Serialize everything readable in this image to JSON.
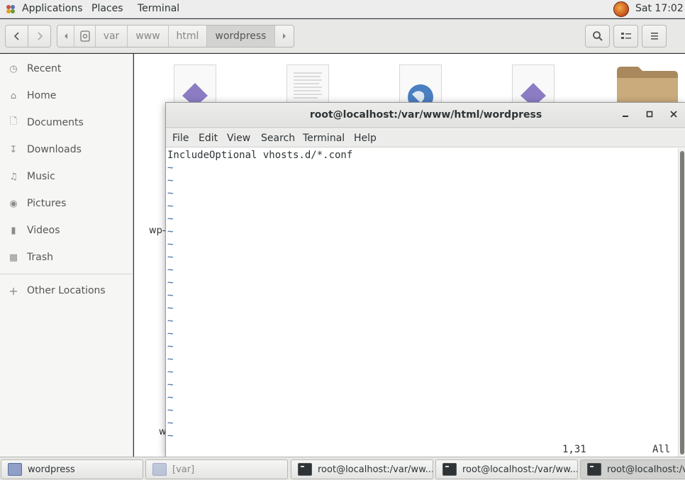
{
  "topbar": {
    "applications": "Applications",
    "places": "Places",
    "terminal": "Terminal",
    "clock": "Sat 17:02"
  },
  "nautilus": {
    "breadcrumbs": [
      "var",
      "www",
      "html",
      "wordpress"
    ],
    "active_crumb": "wordpress",
    "partial_labels": [
      "wp-",
      "w"
    ]
  },
  "sidebar": {
    "items": [
      {
        "label": "Recent",
        "icon": "clock-icon"
      },
      {
        "label": "Home",
        "icon": "home-icon"
      },
      {
        "label": "Documents",
        "icon": "document-icon"
      },
      {
        "label": "Downloads",
        "icon": "download-icon"
      },
      {
        "label": "Music",
        "icon": "music-icon"
      },
      {
        "label": "Pictures",
        "icon": "camera-icon"
      },
      {
        "label": "Videos",
        "icon": "video-icon"
      },
      {
        "label": "Trash",
        "icon": "trash-icon"
      }
    ],
    "other_locations": "Other Locations"
  },
  "terminal": {
    "title": "root@localhost:/var/www/html/wordpress",
    "menus": [
      "File",
      "Edit",
      "View",
      "Search",
      "Terminal",
      "Help"
    ],
    "content_line": "IncludeOptional vhosts.d/*.conf",
    "tilde": "~",
    "tilde_count": 22,
    "cursor_pos": "1,31",
    "scroll_pos": "All"
  },
  "taskbar": {
    "tasks": [
      {
        "label": "wordpress",
        "kind": "files"
      },
      {
        "label": "[var]",
        "kind": "files"
      },
      {
        "label": "root@localhost:/var/ww...",
        "kind": "terminal"
      },
      {
        "label": "root@localhost:/var/ww...",
        "kind": "terminal"
      },
      {
        "label": "root@localhost:/var",
        "kind": "terminal"
      }
    ]
  },
  "colors": {
    "accent_tilde": "#3465a4",
    "topbar_bg": "#ededed"
  }
}
